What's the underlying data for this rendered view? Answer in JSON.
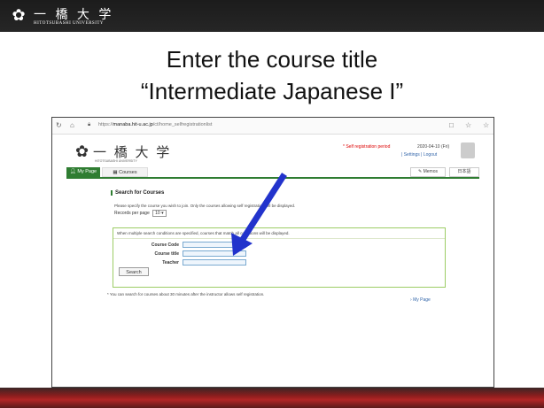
{
  "slide": {
    "logo_kanji": "一 橋 大 学",
    "logo_sub": "HITOTSUBASHI UNIVERSITY",
    "title_line1": "Enter the course title",
    "title_line2": "“Intermediate Japanese I”"
  },
  "browser": {
    "url_prefix": "https://",
    "url_host": "manaba.hit-u.ac.jp",
    "url_path": "/ct/home_selfregistrationlist"
  },
  "site": {
    "logo_kanji": "一 橋 大 学",
    "logo_sub": "HITOTSUBASHI UNIVERSITY",
    "self_registration": "* Self registration period",
    "date": "2020-04-10 (Fri)",
    "settings": "Settings",
    "logout": "Logout",
    "tabs": {
      "my_page": "My Page",
      "courses": "Courses",
      "memos": "Memos",
      "language": "日本語"
    }
  },
  "search": {
    "section_title": "Search for Courses",
    "description": "Please specify the course you wish to join. Only the courses allowing self registration will be displayed.",
    "records_label": "Records per page",
    "records_value": "10",
    "conditions_note": "When multiple search conditions are specified, courses that match all conditions will be displayed.",
    "course_code_label": "Course Code",
    "course_title_label": "Course title",
    "teacher_label": "Teacher",
    "search_button": "Search",
    "footnote": "* You can search for courses about 30 minutes after the instructor allows self registration.",
    "my_page_link": "My Page"
  },
  "colors": {
    "accent_green": "#2f7d32",
    "arrow_blue": "#2233cc",
    "footer_red": "#b02525"
  }
}
